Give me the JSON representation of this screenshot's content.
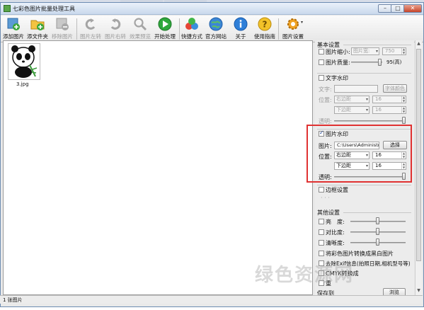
{
  "window": {
    "title": "七彩色图片批量处理工具",
    "min": "–",
    "max": "□",
    "close": "✕"
  },
  "toolbar": {
    "add_image": "添加图片",
    "add_folder": "添文件夹",
    "remove_image": "移除图片",
    "rotate_left": "图片左转",
    "rotate_right": "图片右转",
    "preview": "效果预览",
    "start": "开始处理",
    "shortcut": "快捷方式",
    "website": "官方网站",
    "about": "关于",
    "guide": "使用指南",
    "settings": "图片设置"
  },
  "file": {
    "name": "3.jpg"
  },
  "panel": {
    "basic_title": "基本设置",
    "shrink_label": "图片缩小:",
    "shrink_mode": "图片宽:",
    "shrink_value": "750",
    "quality_label": "图片质量:",
    "quality_value": "95(高)",
    "text_wm": {
      "title": "文字水印",
      "text_label": "文字:",
      "color_btn": "字体颜色",
      "pos_label": "位置:",
      "h_pos": "右边距",
      "h_val": "16",
      "v_pos": "下边距",
      "v_val": "16",
      "alpha_label": "透明:"
    },
    "img_wm": {
      "title": "图片水印",
      "img_label": "图片:",
      "path": "C:\\Users\\Administr",
      "select_btn": "选择",
      "pos_label": "位置:",
      "h_pos": "右边距",
      "h_val": "16",
      "v_pos": "下边距",
      "v_val": "16",
      "alpha_label": "透明:"
    },
    "border": {
      "title": "边框设置",
      "dots": "· · ·"
    },
    "other": {
      "title": "其他设置",
      "brightness": "亮　度:",
      "contrast": "对比度:",
      "sharpness": "清晰度:",
      "grayscale": "将彩色图片转换成黑白图片",
      "exif": "去除Exif信息(拍照日期,相机型号等)",
      "cmyk": "CMYK转换成",
      "rename": "重",
      "output": "保存到",
      "browse": "浏览"
    }
  },
  "status": {
    "count": "1 张图片"
  },
  "watermark_text": "绿色资源网"
}
